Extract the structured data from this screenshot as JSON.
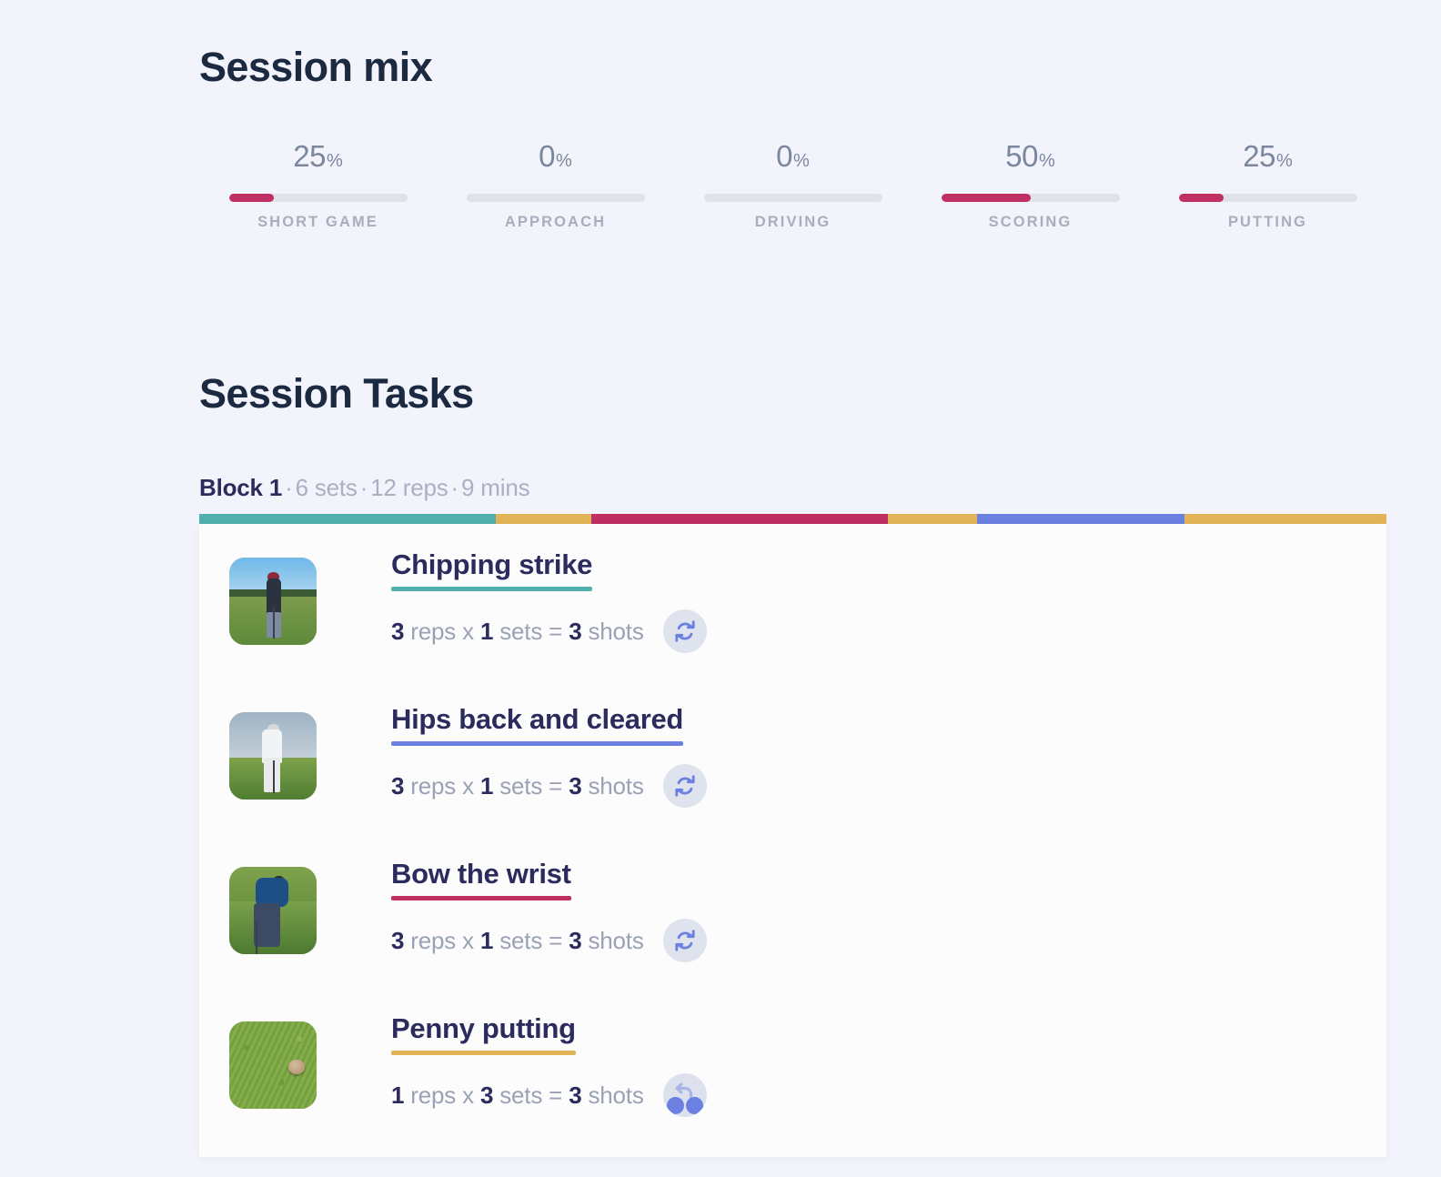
{
  "session_mix": {
    "title": "Session mix",
    "items": [
      {
        "label": "SHORT GAME",
        "value": "25",
        "sign": "%",
        "percent": 25
      },
      {
        "label": "APPROACH",
        "value": "0",
        "sign": "%",
        "percent": 0
      },
      {
        "label": "DRIVING",
        "value": "0",
        "sign": "%",
        "percent": 0
      },
      {
        "label": "SCORING",
        "value": "50",
        "sign": "%",
        "percent": 50
      },
      {
        "label": "PUTTING",
        "value": "25",
        "sign": "%",
        "percent": 25
      }
    ],
    "bar_fill_color": "#bf2f62",
    "bar_track_color": "#dfe2e9"
  },
  "session_tasks": {
    "title": "Session Tasks",
    "block": {
      "name": "Block 1",
      "sets": "6 sets",
      "reps": "12 reps",
      "mins": "9 mins",
      "separator": "·"
    },
    "stripe": [
      {
        "color": "#4fb0ac",
        "width": 25.0
      },
      {
        "color": "#e3b457",
        "width": 8.0
      },
      {
        "color": "#bf2f62",
        "width": 25.0
      },
      {
        "color": "#e3b457",
        "width": 7.5
      },
      {
        "color": "#6b80e0",
        "width": 17.5
      },
      {
        "color": "#e3b457",
        "width": 17.0
      }
    ],
    "tasks": [
      {
        "name": "Chipping strike",
        "underline_color": "#4fb0ac",
        "reps": "3",
        "reps_word": "reps",
        "x": "x",
        "sets": "1",
        "sets_word": "sets",
        "equals": "=",
        "shots": "3",
        "shots_word": "shots",
        "icon": "loop-icon",
        "thumb_variant": "v1",
        "thumb_alt": "golfer chipping on grass with trees"
      },
      {
        "name": "Hips back and cleared",
        "underline_color": "#6b80e0",
        "reps": "3",
        "reps_word": "reps",
        "x": "x",
        "sets": "1",
        "sets_word": "sets",
        "equals": "=",
        "shots": "3",
        "shots_word": "shots",
        "icon": "loop-icon",
        "thumb_variant": "v2",
        "thumb_alt": "golfer in white at impact on fairway"
      },
      {
        "name": "Bow the wrist",
        "underline_color": "#bf2f62",
        "reps": "3",
        "reps_word": "reps",
        "x": "x",
        "sets": "1",
        "sets_word": "sets",
        "equals": "=",
        "shots": "3",
        "shots_word": "shots",
        "icon": "loop-icon",
        "thumb_variant": "v3",
        "thumb_alt": "golfer in blue shirt addressing ball"
      },
      {
        "name": "Penny putting",
        "underline_color": "#e3b457",
        "reps": "1",
        "reps_word": "reps",
        "x": "x",
        "sets": "3",
        "sets_word": "sets",
        "equals": "=",
        "shots": "3",
        "shots_word": "shots",
        "icon": "loop-icon-partial",
        "thumb_variant": "v4",
        "thumb_alt": "penny resting on putting green grass"
      }
    ]
  },
  "colors": {
    "page_background": "#f3f3fb",
    "card_background": "#fcfcfd",
    "heading": "#1b2a41",
    "accent_indigo": "#2b2b5e",
    "muted_text": "#9aa2b4",
    "teal": "#4fb0ac",
    "gold": "#e3b457",
    "crimson": "#bf2f62",
    "periwinkle": "#6b80e0"
  }
}
